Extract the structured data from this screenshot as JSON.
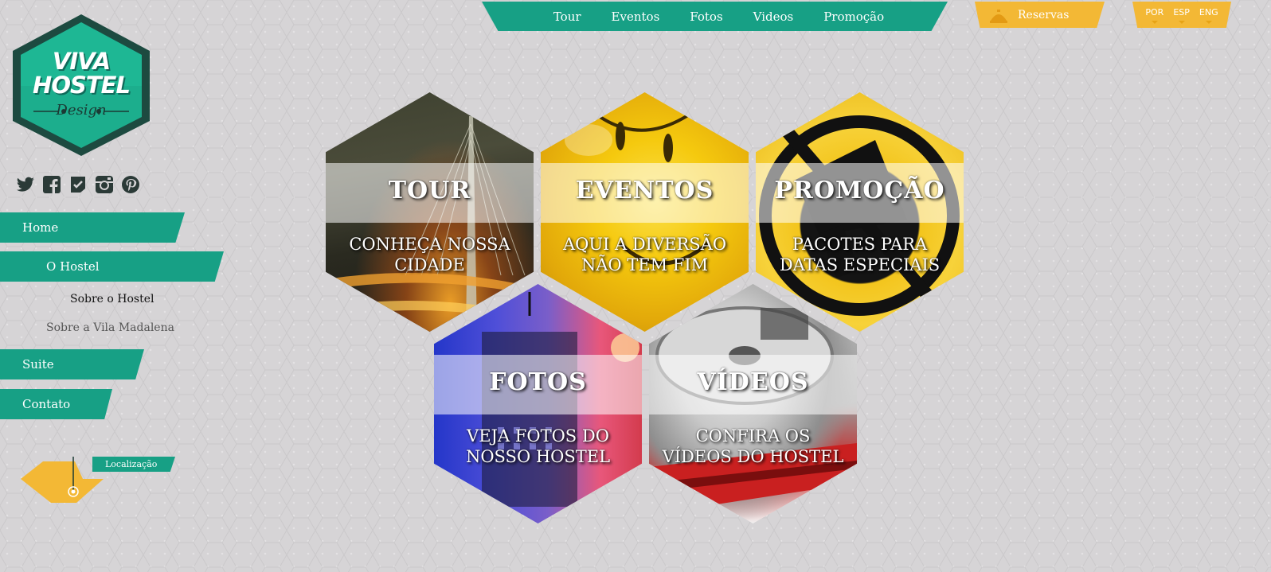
{
  "topnav": {
    "items": [
      "Tour",
      "Eventos",
      "Fotos",
      "Videos",
      "Promoção"
    ]
  },
  "reservas": {
    "label": "Reservas"
  },
  "languages": [
    "POR",
    "ESP",
    "ENG"
  ],
  "logo": {
    "line1": "VIVA",
    "line2": "HOSTEL",
    "line3": "Design"
  },
  "social": [
    "twitter-icon",
    "facebook-icon",
    "foursquare-icon",
    "instagram-icon",
    "pinterest-icon"
  ],
  "sidebar": {
    "home": "Home",
    "hostel": "O Hostel",
    "sub_items": [
      "Sobre o Hostel",
      "Sobre a Vila Madalena"
    ],
    "suite": "Suite",
    "contato": "Contato"
  },
  "location": {
    "label": "Localização"
  },
  "tiles": [
    {
      "title": "TOUR",
      "subtitle": "CONHEÇA NOSSA CIDADE"
    },
    {
      "title": "EVENTOS",
      "subtitle": "AQUI A DIVERSÃO NÃO TEM FIM"
    },
    {
      "title": "PROMOÇÃO",
      "subtitle": "PACOTES  PARA DATAS ESPECIAIS"
    },
    {
      "title": "FOTOS",
      "subtitle": "VEJA FOTOS DO NOSSO HOSTEL"
    },
    {
      "title": "VÍDEOS",
      "subtitle": "CONFIRA OS VÍDEOS DO HOSTEL"
    }
  ],
  "colors": {
    "accent": "#17a085",
    "yellow": "#f3b835",
    "background": "#d6d4d6"
  }
}
